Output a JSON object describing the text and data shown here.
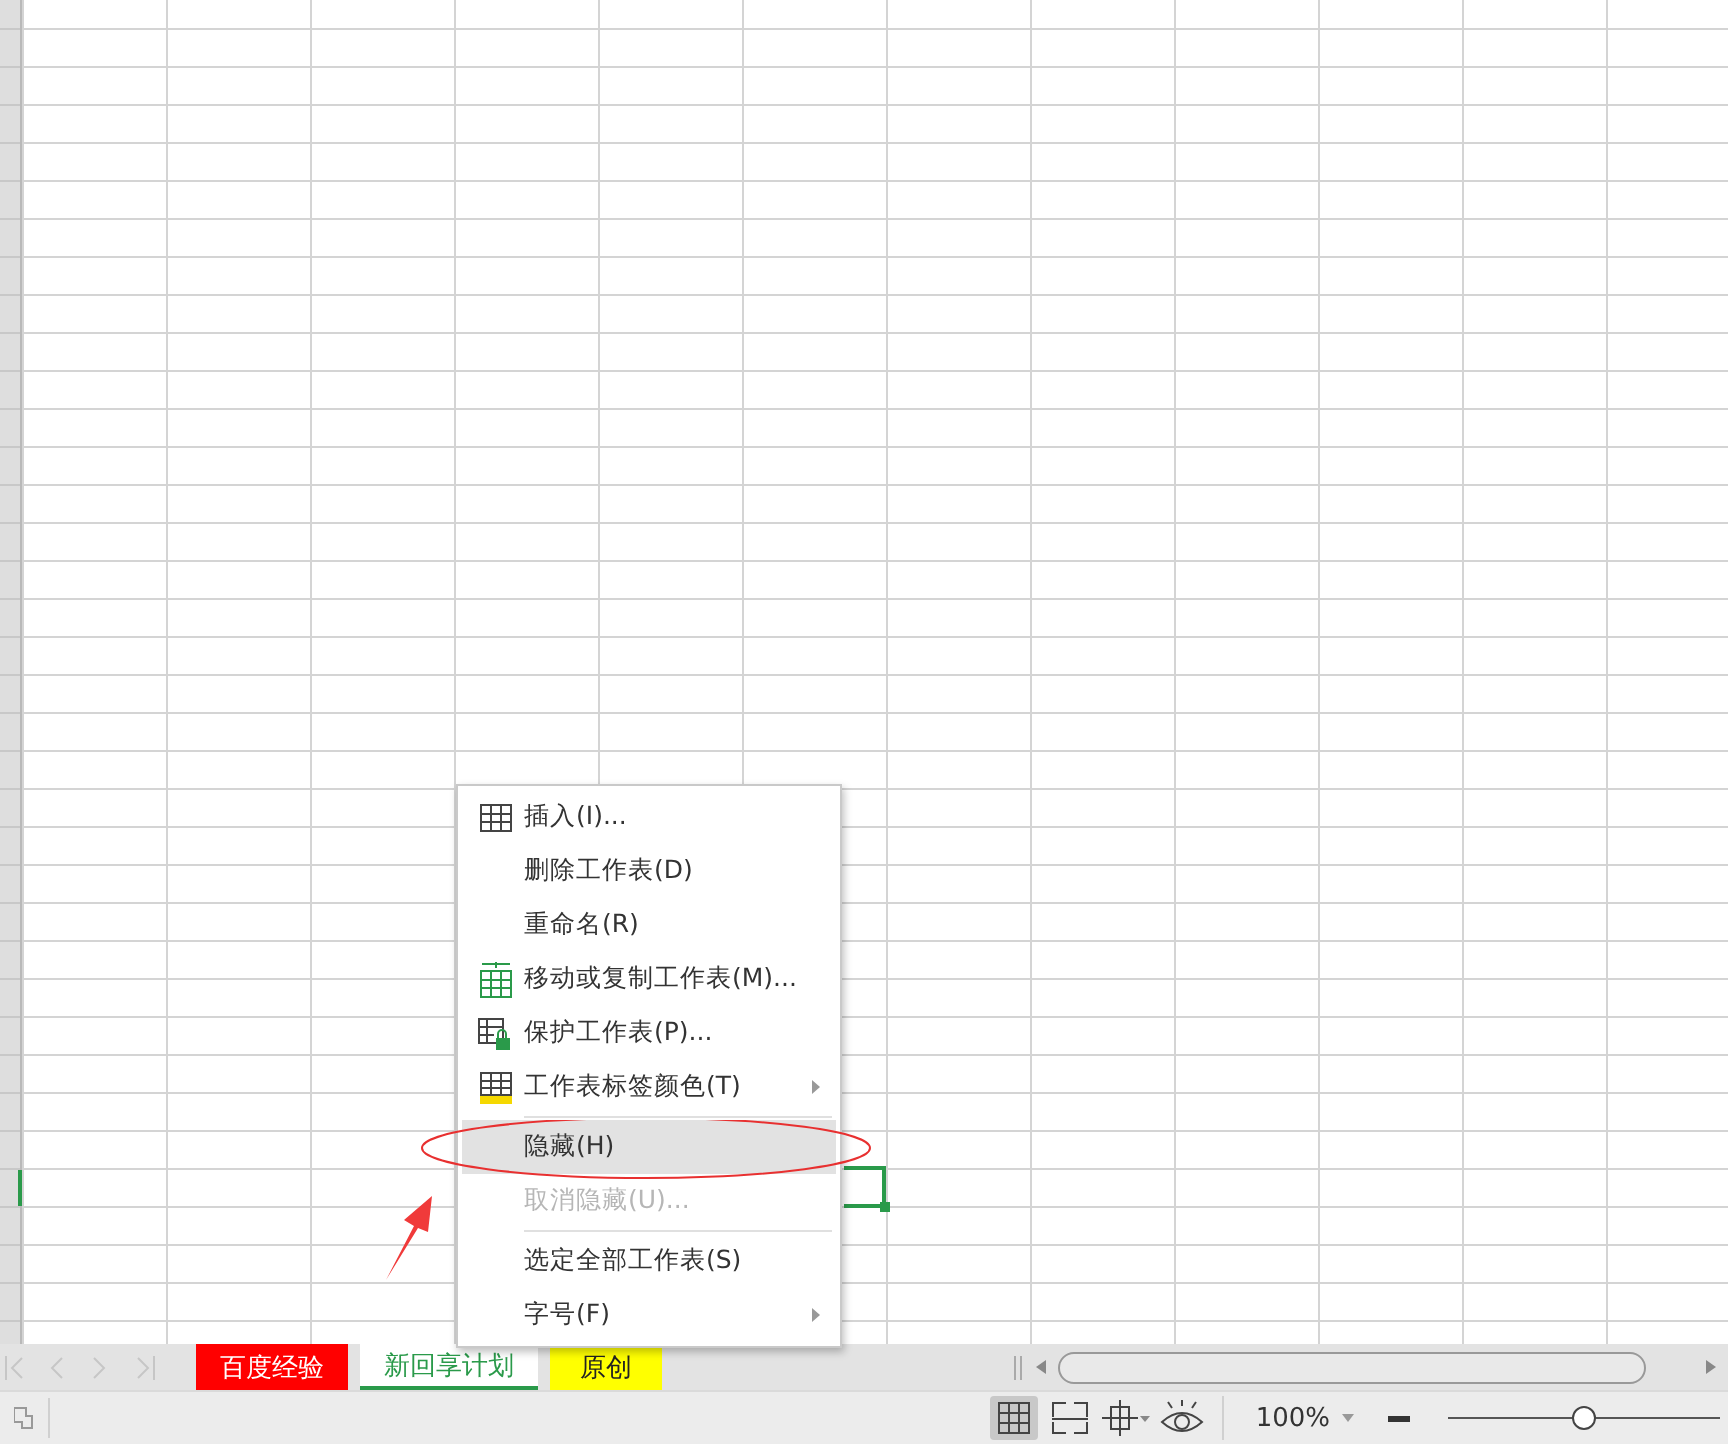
{
  "sheet_tabs": [
    {
      "label": "百度经验",
      "color": "#ff0000",
      "selected": false
    },
    {
      "label": "新回享计划",
      "color": "#ffffff",
      "selected": true
    },
    {
      "label": "原创",
      "color": "#ffff00",
      "selected": false
    }
  ],
  "context_menu": {
    "items": [
      {
        "kind": "insert",
        "label": "插入(I)...",
        "disabled": false,
        "selected": false,
        "submenu": false
      },
      {
        "kind": "plain",
        "label": "删除工作表(D)",
        "disabled": false,
        "selected": false,
        "submenu": false
      },
      {
        "kind": "plain",
        "label": "重命名(R)",
        "disabled": false,
        "selected": false,
        "submenu": false
      },
      {
        "kind": "move",
        "label": "移动或复制工作表(M)...",
        "disabled": false,
        "selected": false,
        "submenu": false
      },
      {
        "kind": "protect",
        "label": "保护工作表(P)...",
        "disabled": false,
        "selected": false,
        "submenu": false
      },
      {
        "kind": "tabcolor",
        "label": "工作表标签颜色(T)",
        "disabled": false,
        "selected": false,
        "submenu": true
      },
      {
        "kind": "separator"
      },
      {
        "kind": "plain",
        "label": "隐藏(H)",
        "disabled": false,
        "selected": true,
        "submenu": false
      },
      {
        "kind": "plain",
        "label": "取消隐藏(U)...",
        "disabled": true,
        "selected": false,
        "submenu": false
      },
      {
        "kind": "separator"
      },
      {
        "kind": "plain",
        "label": "选定全部工作表(S)",
        "disabled": false,
        "selected": false,
        "submenu": false
      },
      {
        "kind": "plain",
        "label": "字号(F)",
        "disabled": false,
        "selected": false,
        "submenu": true
      }
    ]
  },
  "status_bar": {
    "view_modes": [
      {
        "kind": "normal",
        "selected": true
      },
      {
        "kind": "pagebreak",
        "selected": false
      },
      {
        "kind": "layout",
        "selected": false
      },
      {
        "kind": "reading",
        "selected": false
      }
    ],
    "zoom": {
      "value": "100%",
      "level": 0.5
    }
  }
}
